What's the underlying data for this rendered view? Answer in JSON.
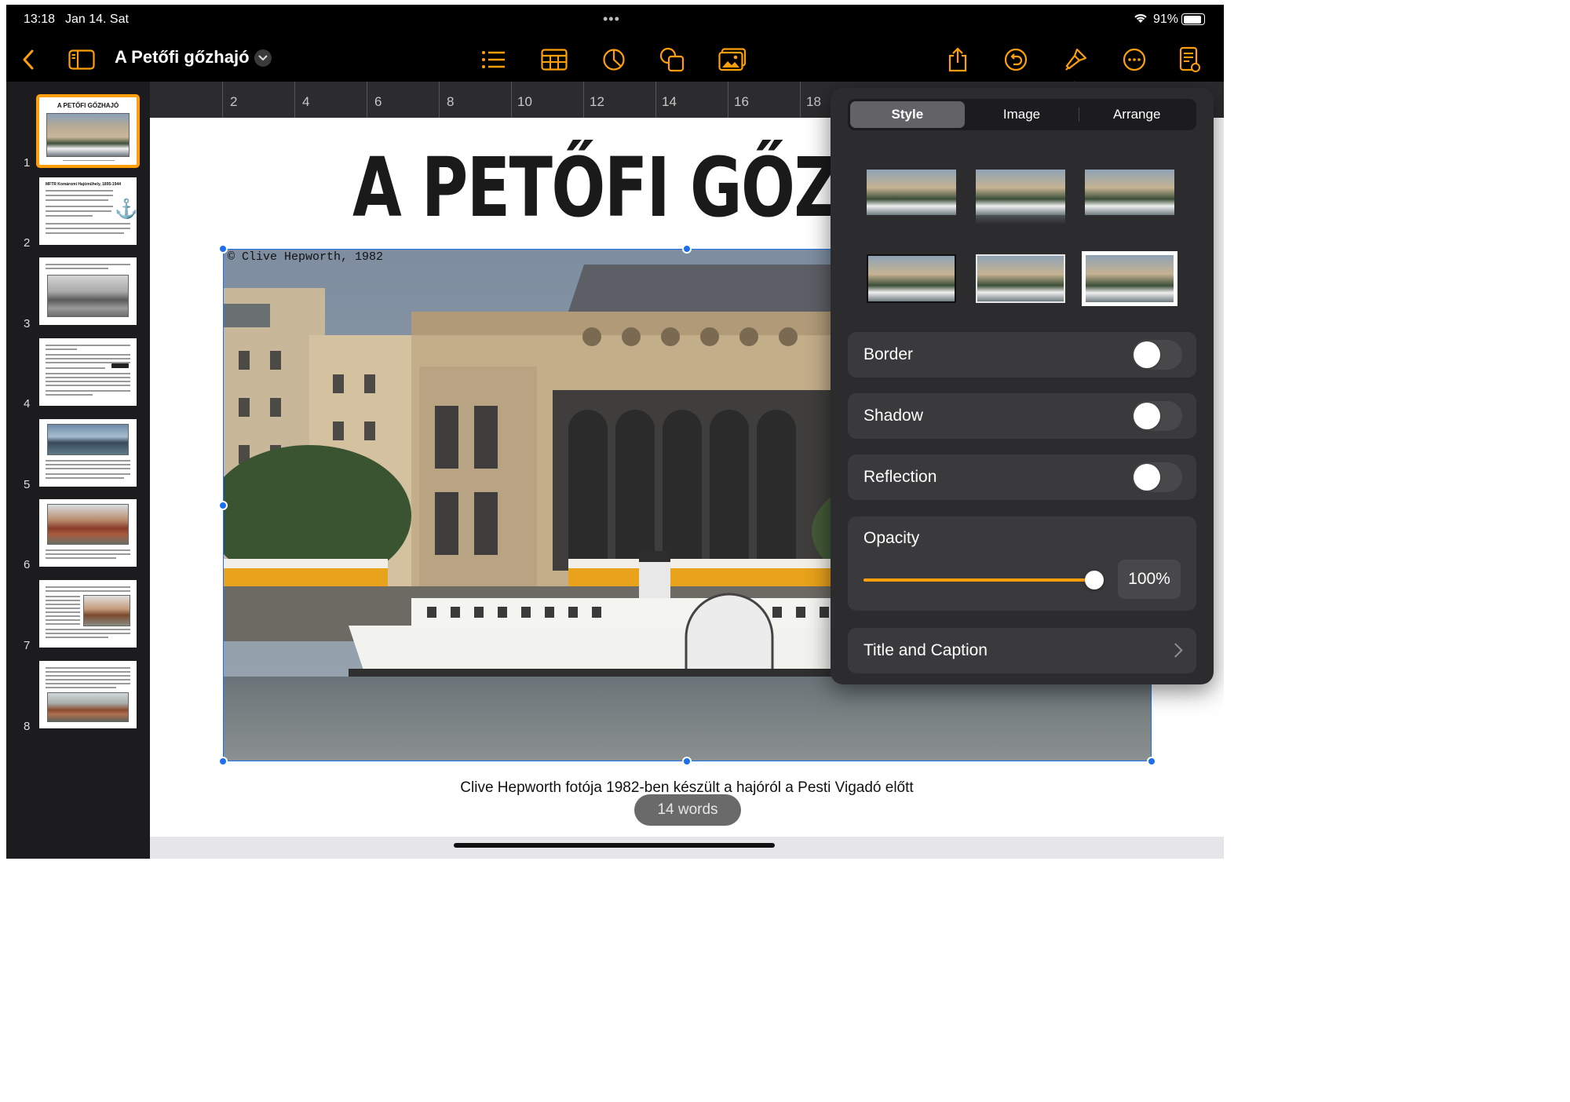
{
  "status_bar": {
    "time": "13:18",
    "date": "Jan 14. Sat",
    "battery": "91%"
  },
  "toolbar": {
    "title": "A Petőfi gőzhajó",
    "icons": [
      "back-chevron-icon",
      "sidebar-toggle-icon",
      "list-icon",
      "table-icon",
      "chart-icon",
      "shape-icon",
      "media-icon",
      "share-icon",
      "undo-icon",
      "format-brush-icon",
      "more-icon",
      "document-options-icon"
    ]
  },
  "ruler": {
    "labels": [
      "2",
      "4",
      "6",
      "8",
      "10",
      "12",
      "14",
      "16",
      "18"
    ]
  },
  "sidebar": {
    "slides": [
      {
        "number": "1",
        "title": "A PETŐFI GŐZHAJÓ"
      },
      {
        "number": "2",
        "title": "MFTR Komáromi Hajóműhely, 1895-1944"
      },
      {
        "number": "3"
      },
      {
        "number": "4"
      },
      {
        "number": "5"
      },
      {
        "number": "6"
      },
      {
        "number": "7"
      },
      {
        "number": "8"
      }
    ]
  },
  "slide": {
    "title": "A PETŐFI GŐZ",
    "photo_credit": "© Clive Hepworth, 1982",
    "caption": "Clive Hepworth fotója 1982-ben készült a hajóról a Pesti Vigadó előtt",
    "word_count": "14 words"
  },
  "format_panel": {
    "tabs": [
      "Style",
      "Image",
      "Arrange"
    ],
    "active_tab": "Style",
    "border": {
      "label": "Border",
      "on": false
    },
    "shadow": {
      "label": "Shadow",
      "on": false
    },
    "reflection": {
      "label": "Reflection",
      "on": false
    },
    "opacity": {
      "label": "Opacity",
      "value": "100%",
      "fraction": 1.0
    },
    "title_caption": {
      "label": "Title and Caption"
    }
  },
  "colors": {
    "accent": "#ff9f0a",
    "selection": "#1e6ff0"
  }
}
